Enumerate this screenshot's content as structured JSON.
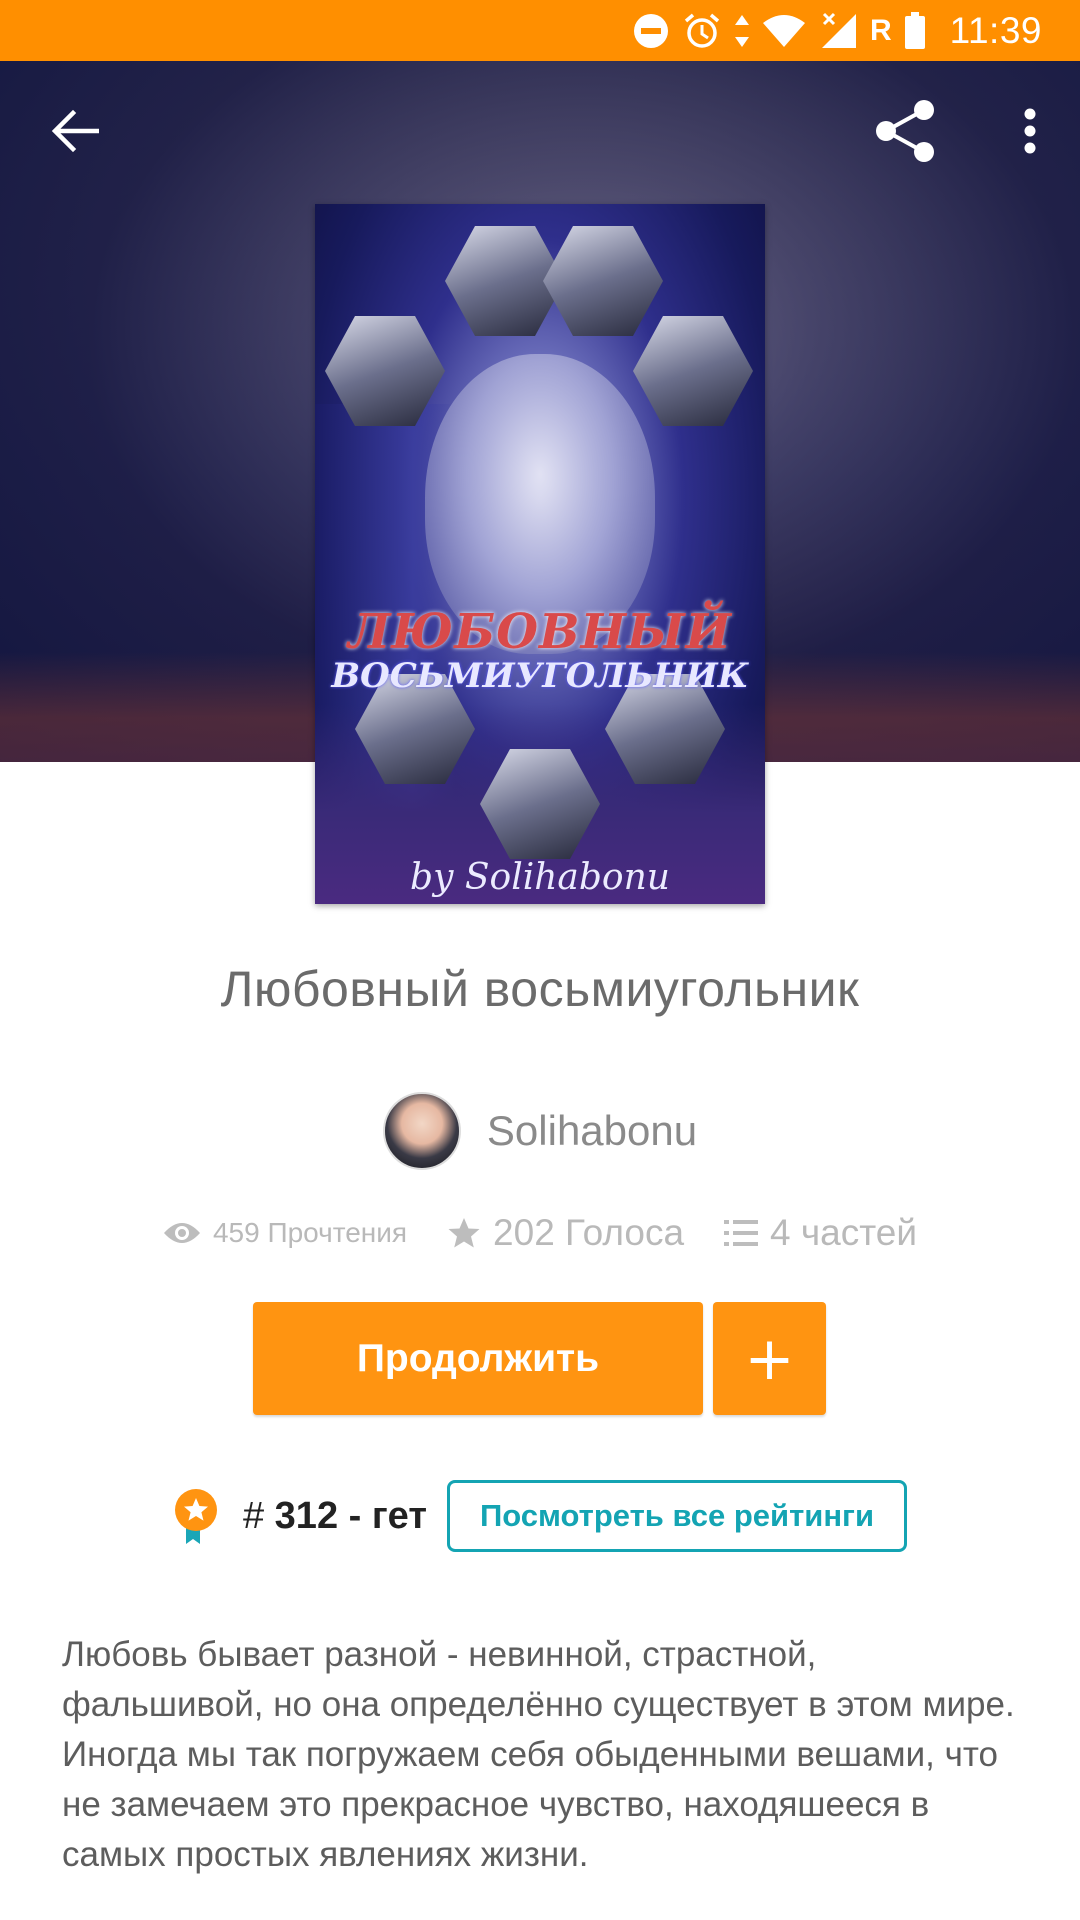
{
  "status_bar": {
    "time": "11:39",
    "network_letter": "R",
    "icons": [
      "do-not-disturb-icon",
      "alarm-icon",
      "data-arrows-icon",
      "wifi-icon",
      "signal-icon",
      "battery-icon"
    ]
  },
  "toolbar": {
    "back_icon": "arrow-left-icon",
    "share_icon": "share-icon",
    "more_icon": "more-vertical-icon"
  },
  "cover": {
    "title_line1": "ЛЮБОВНЫЙ",
    "title_line2": "ВОСЬМИУГОЛЬНИК",
    "author_signature": "by Solihabonu"
  },
  "book": {
    "title": "Любовный восьмиугольник",
    "author": "Solihabonu"
  },
  "stats": {
    "reads": "459 Прочтения",
    "votes": "202 Голоса",
    "parts": "4 частей"
  },
  "actions": {
    "continue_label": "Продолжить",
    "add_label": "+"
  },
  "ranking": {
    "hash": "#",
    "rank": "312",
    "tag": "гет",
    "separator": "-",
    "view_all_label": "Посмотреть все рейтинги"
  },
  "description": "Любовь бывает разной - невинной, страстной, фальшивой, но она определённо существует в этом мире. Иногда мы так погружаем себя обыденными вешами, что не замечаем это прекрасное чувство, находяшееся в самых простых явлениях жизни.",
  "colors": {
    "accent": "#ff9411",
    "status_bar": "#ff8f00",
    "teal": "#14a4b3"
  }
}
